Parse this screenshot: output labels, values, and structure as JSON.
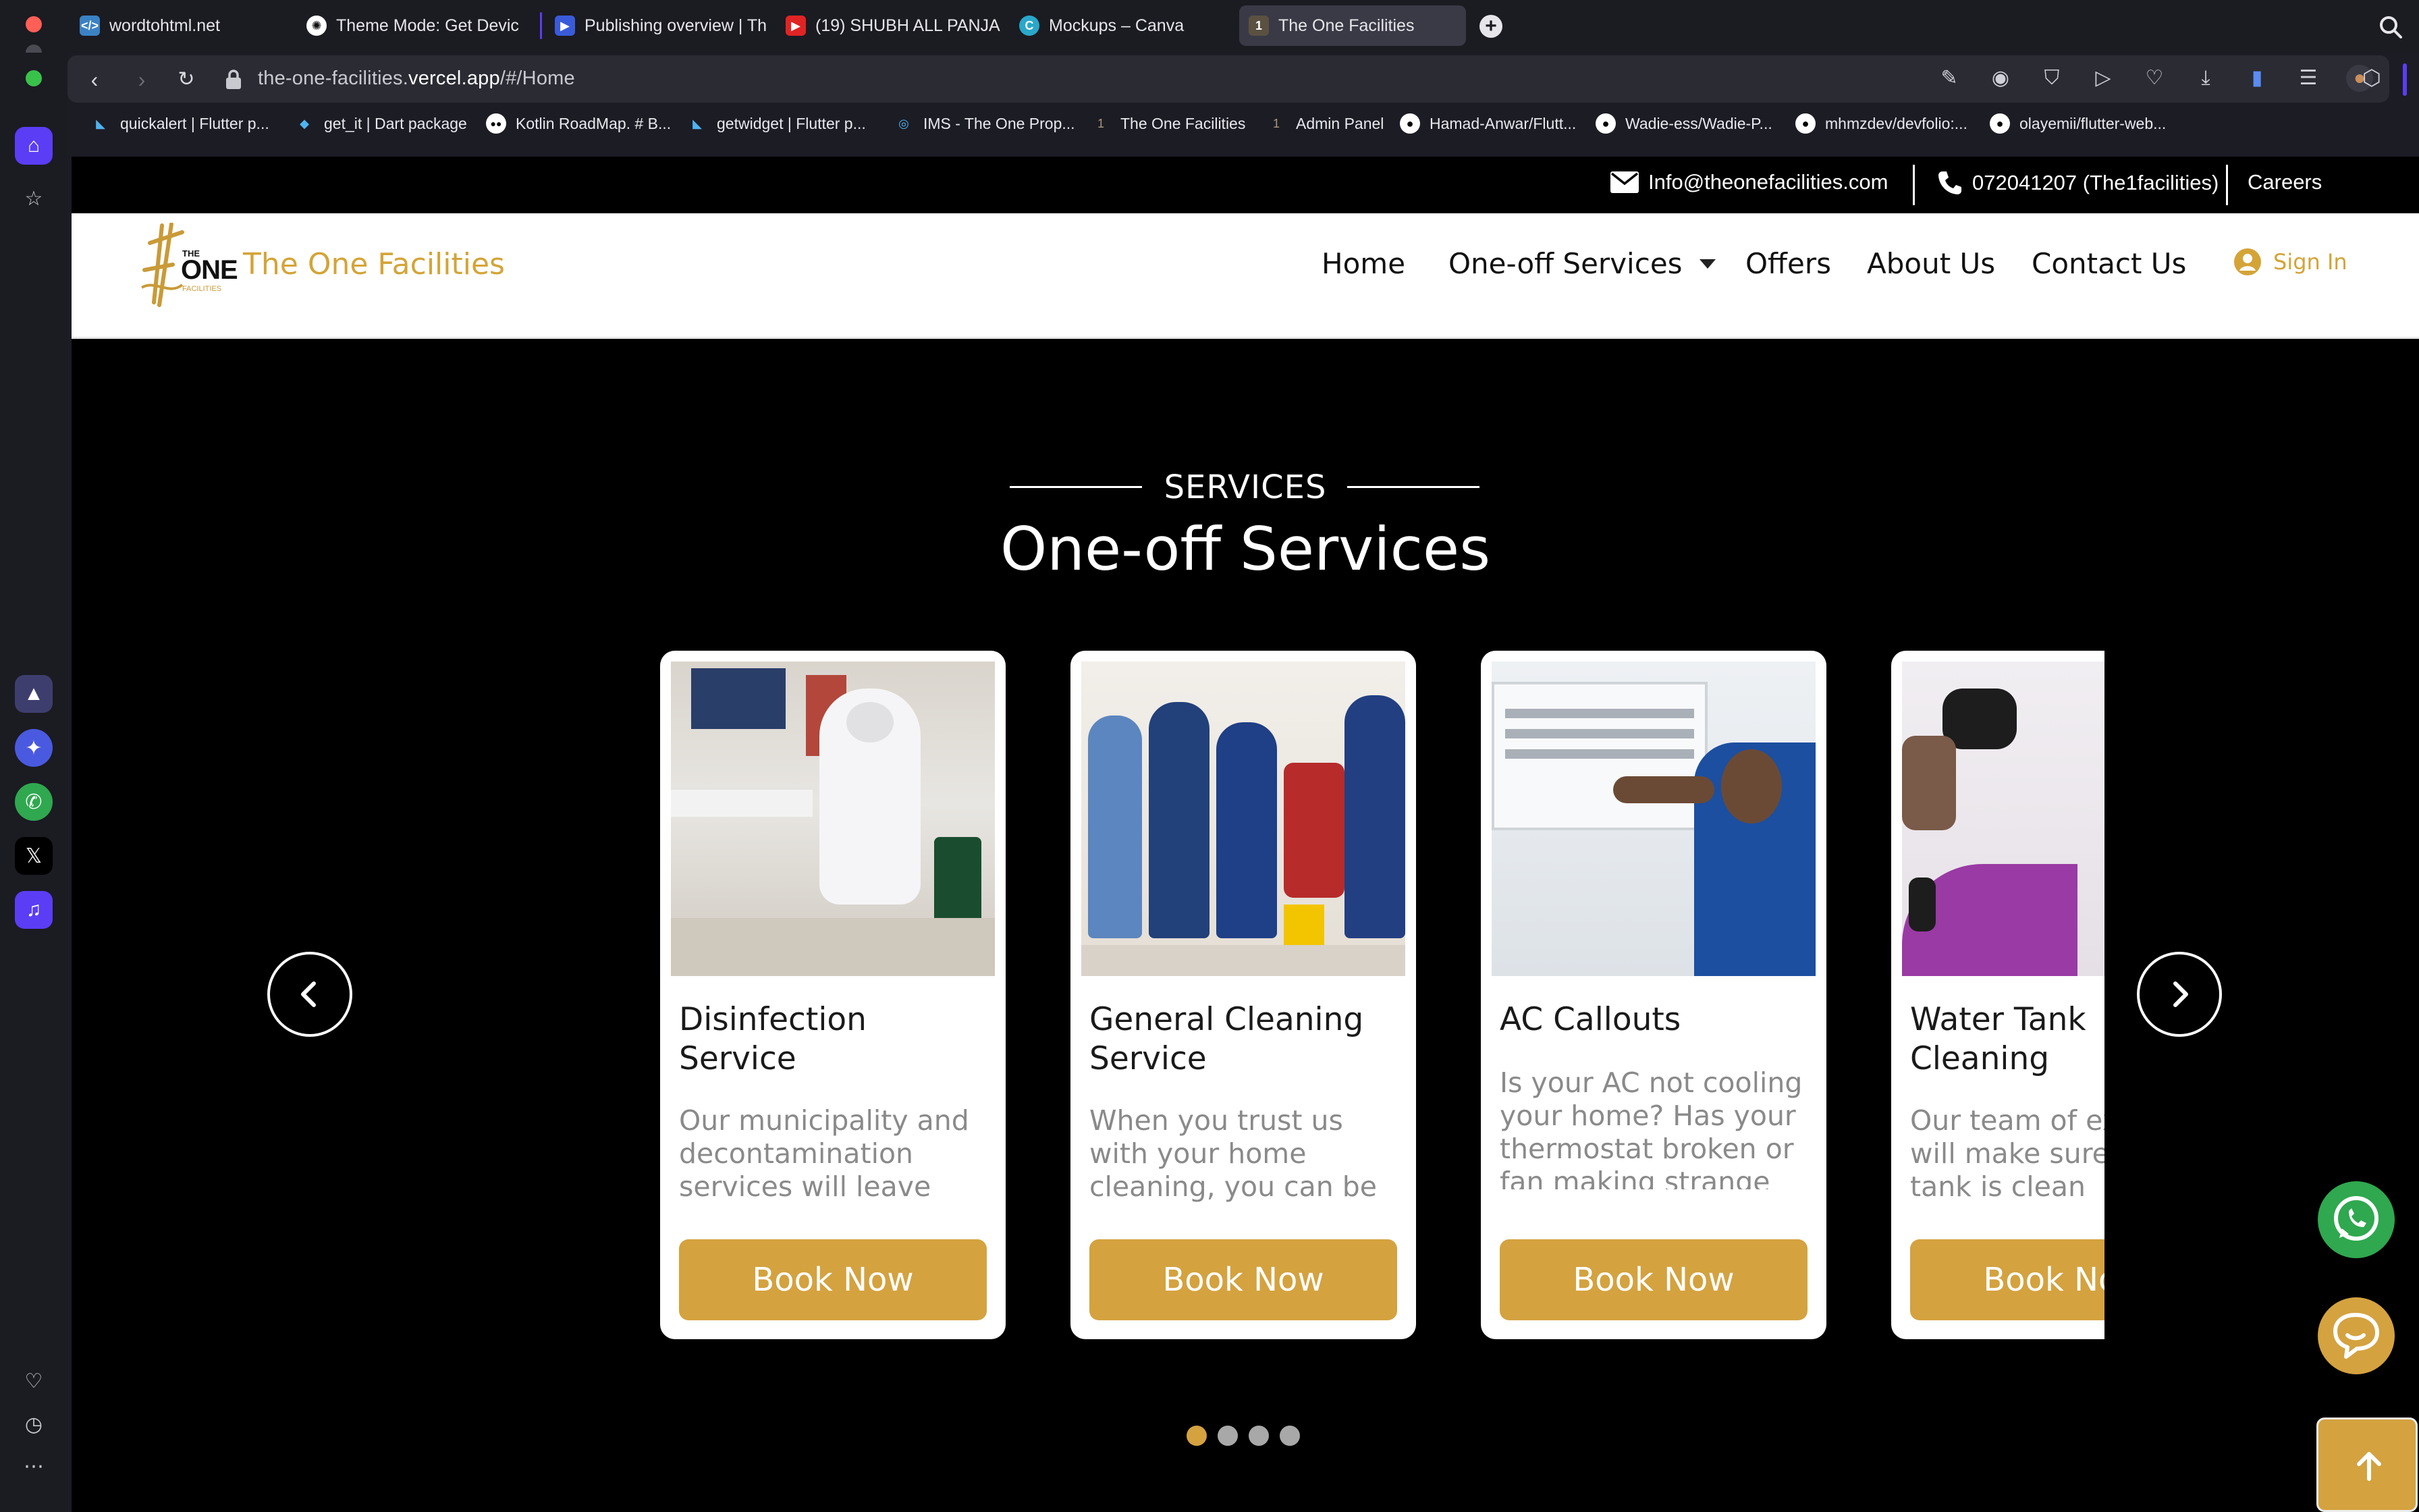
{
  "browser": {
    "tabs": [
      {
        "title": "wordtohtml.net"
      },
      {
        "title": "Theme Mode: Get Devic"
      },
      {
        "title": "Publishing overview | Th"
      },
      {
        "title": "(19) SHUBH ALL PANJA"
      },
      {
        "title": "Mockups – Canva"
      },
      {
        "title": "The One Facilities",
        "active": true
      }
    ],
    "url_prefix": "the-one-facilities.",
    "url_host": "vercel.app",
    "url_path": "/#/Home",
    "bookmarks": [
      {
        "label": "quickalert | Flutter p..."
      },
      {
        "label": "get_it | Dart package"
      },
      {
        "label": "Kotlin RoadMap. # B..."
      },
      {
        "label": "getwidget | Flutter p..."
      },
      {
        "label": "IMS - The One Prop..."
      },
      {
        "label": "The One Facilities"
      },
      {
        "label": "Admin Panel"
      },
      {
        "label": "Hamad-Anwar/Flutt..."
      },
      {
        "label": "Wadie-ess/Wadie-P..."
      },
      {
        "label": "mhmzdev/devfolio:..."
      },
      {
        "label": "olayemii/flutter-web..."
      }
    ]
  },
  "topbar": {
    "email": "Info@theonefacilities.com",
    "phone": "072041207 (The1facilities)",
    "careers": "Careers"
  },
  "nav": {
    "logo_top": "THE",
    "logo_main": "ONE",
    "logo_sub": "FACILITIES",
    "brand": "The One Facilities",
    "links": {
      "home": "Home",
      "one_off": "One-off Services",
      "offers": "Offers",
      "about": "About Us",
      "contact": "Contact Us"
    },
    "sign_in": "Sign In"
  },
  "services": {
    "eyebrow": "SERVICES",
    "title": "One-off Services",
    "cards": [
      {
        "title_line1": "Disinfection",
        "title_line2": "Service",
        "desc": "Our municipality and decontamination services will leave your",
        "button": "Book Now"
      },
      {
        "title_line1": "General Cleaning",
        "title_line2": "Service",
        "desc": "When you trust us with your home cleaning, you can be",
        "button": "Book Now"
      },
      {
        "title_line1": "AC Callouts",
        "title_line2": "",
        "desc": "Is your AC not cooling your home? Has your thermostat broken or fan making strange noises? Give us a call",
        "button": "Book Now"
      },
      {
        "title_line1": "Water Tank",
        "title_line2": "Cleaning",
        "desc": "Our team of experts will make sure your tank is clean",
        "button": "Book Now"
      }
    ],
    "dots": 4,
    "active_dot": 0
  },
  "colors": {
    "accent": "#d4a23f",
    "page_bg": "#000000",
    "whatsapp": "#2fa84f",
    "browser_bg": "#1b1b22"
  }
}
